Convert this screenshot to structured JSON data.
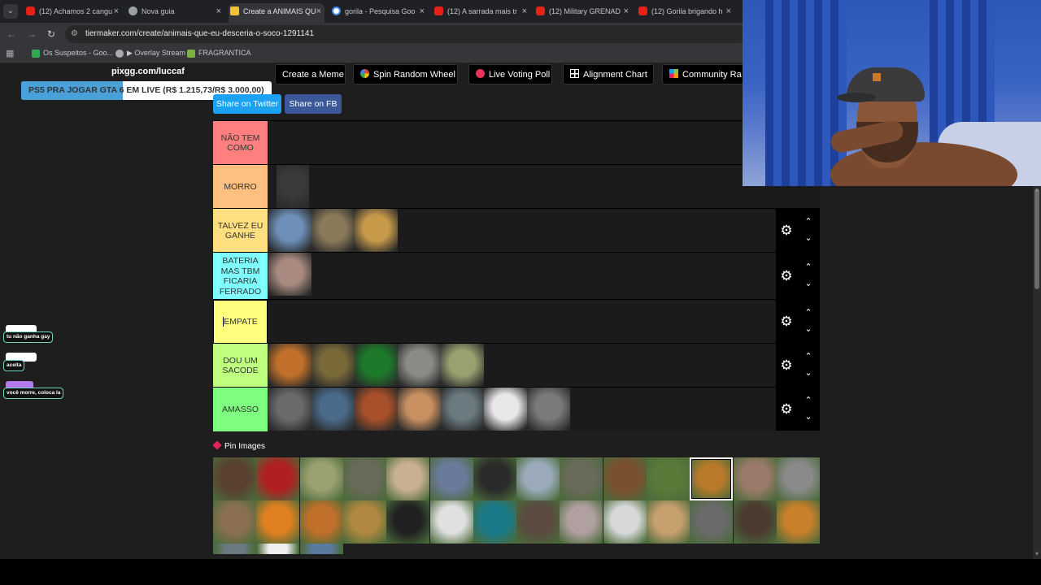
{
  "browser": {
    "tabs": [
      {
        "title": "(12) Achamos 2 cangu",
        "icon": "youtube-icon",
        "active": false
      },
      {
        "title": "Nova guia",
        "icon": "chrome-icon",
        "active": false
      },
      {
        "title": "Create a ANIMAIS QU",
        "icon": "tiermaker-icon",
        "active": true
      },
      {
        "title": "gorila - Pesquisa Goo",
        "icon": "google-icon",
        "active": false
      },
      {
        "title": "(12) A sarrada mais tr",
        "icon": "youtube-icon",
        "active": false
      },
      {
        "title": "(12) Military GRENAD",
        "icon": "youtube-icon",
        "active": false
      },
      {
        "title": "(12) Gorila brigando h",
        "icon": "youtube-icon",
        "active": false
      }
    ],
    "close_glyph": "×",
    "url": "tiermaker.com/create/animais-que-eu-desceria-o-soco-1291141",
    "bookmarks": [
      {
        "label": "Os Suspeitos - Goo...",
        "icon": "drive-icon"
      },
      {
        "label": "▶ Overlay Stream",
        "icon": "globe-icon"
      },
      {
        "label": "FRAGRANTICA",
        "icon": "fragrantica-icon"
      }
    ]
  },
  "overlay": {
    "pix_url": "pixgg.com/luccaf",
    "promo": {
      "text": "PS5 PRA JOGAR GTA 6 EM LIVE (R$ 1.215,73/R$ 3.000,00)",
      "raised": 1215.73,
      "goal": 3000.0
    },
    "chat": [
      {
        "text": "tu não ganha gay",
        "badge_color": "#ffffff"
      },
      {
        "text": "aceita",
        "badge_color": "#ffffff"
      },
      {
        "text": "você morre, coloca la",
        "badge_color": "#b57bee"
      }
    ]
  },
  "toolbar": {
    "buttons": [
      {
        "label": "Create a Meme",
        "icon": ""
      },
      {
        "label": "Spin Random Wheel",
        "icon": "wheel-icon"
      },
      {
        "label": "Live Voting Poll",
        "icon": "red-dot-icon"
      },
      {
        "label": "Alignment Chart",
        "icon": "grid-icon"
      },
      {
        "label": "Community Ra",
        "icon": "community-icon"
      }
    ],
    "share_twitter": "Share on Twitter",
    "share_fb": "Share on FB"
  },
  "tiers": [
    {
      "label": "NÃO TEM COMO",
      "color": "#ff7f7f",
      "items": [],
      "has_controls": false
    },
    {
      "label": "MORRO",
      "color": "#ffbf7f",
      "items": [
        "gorilla"
      ],
      "has_controls": false
    },
    {
      "label": "TALVEZ EU GANHE",
      "color": "#ffdf7f",
      "items": [
        "eagle",
        "moose",
        "giraffe"
      ],
      "has_controls": true
    },
    {
      "label": "BATERIA MAS TBM FICARIA FERRADO",
      "color": "#7fffff",
      "items": [
        "ape"
      ],
      "has_controls": true
    },
    {
      "label": "EMPATE",
      "color": "#ffff7f",
      "items": [],
      "has_controls": true,
      "editing": true
    },
    {
      "label": "DOU UM SACODE",
      "color": "#bfff7f",
      "items": [
        "orangutan",
        "deer",
        "snake",
        "elephant",
        "cheetah"
      ],
      "has_controls": true
    },
    {
      "label": "AMASSO",
      "color": "#7fff7f",
      "items": [
        "ostrich",
        "zebra",
        "mole",
        "caracal",
        "seal",
        "goose",
        "raccoon"
      ],
      "has_controls": true
    }
  ],
  "icons": {
    "gear": "⚙",
    "chev_up": "⌃",
    "chev_down": "⌄"
  },
  "pin_images": {
    "title": "Pin Images",
    "items": [
      "bison",
      "red-panther",
      "cheetah",
      "bald-eagle",
      "hyena",
      "hippo",
      "rottweiler",
      "husky",
      "warthog",
      "beaver",
      "crocodile",
      "lion",
      "kangaroo",
      "wolf",
      "otter",
      "red-monkey",
      "orangutan",
      "jaguar",
      "black-panther",
      "swan",
      "peacock",
      "turkey",
      "pitbull",
      "penguin",
      "bird",
      "rhino",
      "boar",
      "tiger",
      "seal",
      "panda",
      "shark"
    ],
    "selected": "lion"
  }
}
